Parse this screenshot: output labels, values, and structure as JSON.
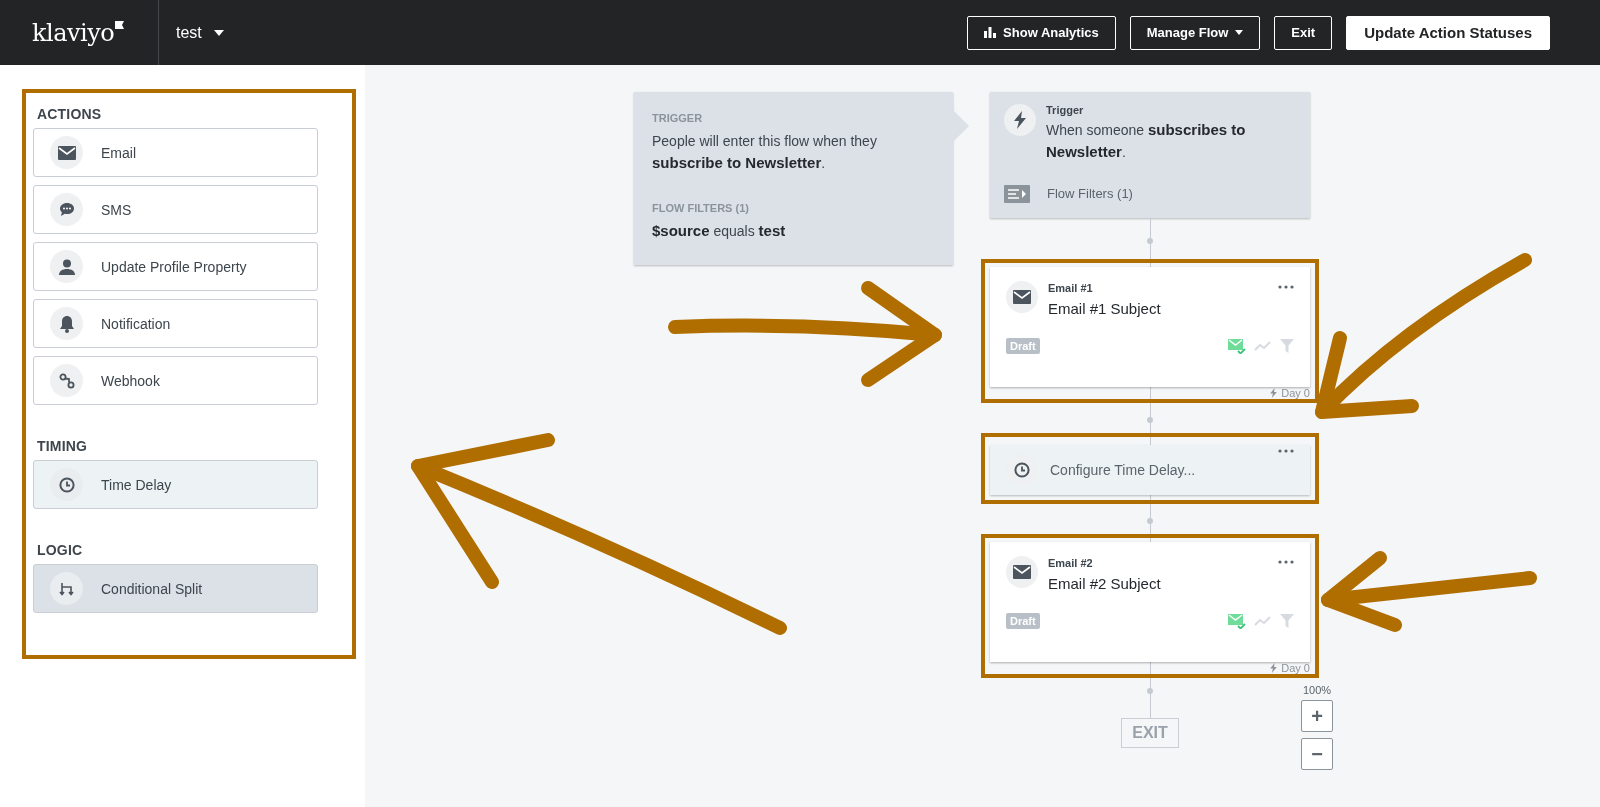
{
  "topbar": {
    "logo": "klaviyo",
    "flow_name": "test",
    "buttons": [
      {
        "label": "Show Analytics",
        "kind": "analytics"
      },
      {
        "label": "Manage Flow",
        "kind": "dropdown"
      },
      {
        "label": "Exit",
        "kind": "plain"
      },
      {
        "label": "Update Action Statuses",
        "kind": "primary"
      }
    ]
  },
  "sidebar": {
    "highlighted": true,
    "sections": [
      {
        "title": "ACTIONS",
        "kind": "action",
        "items": [
          {
            "label": "Email",
            "kind": "email"
          },
          {
            "label": "SMS",
            "kind": "sms"
          },
          {
            "label": "Update Profile Property",
            "kind": "profile"
          },
          {
            "label": "Notification",
            "kind": "notification"
          },
          {
            "label": "Webhook",
            "kind": "webhook"
          }
        ]
      },
      {
        "title": "TIMING",
        "kind": "timing",
        "items": [
          {
            "label": "Time Delay",
            "kind": "delay"
          }
        ]
      },
      {
        "title": "LOGIC",
        "kind": "logic",
        "items": [
          {
            "label": "Conditional Split",
            "kind": "split"
          }
        ]
      }
    ]
  },
  "trigger_info": {
    "label": "TRIGGER",
    "text": "People will enter this flow when they **subscribe to Newsletter**.",
    "filters_label": "FLOW FILTERS (1)",
    "filter": "**$source** equals **test**"
  },
  "trigger_card": {
    "label": "Trigger",
    "text": "When someone **subscribes to Newsletter**.",
    "filters": "Flow Filters (1)"
  },
  "flow": [
    {
      "kind": "email",
      "label": "Email #1",
      "subject": "Email #1 Subject",
      "status": "Draft",
      "day": "Day 0",
      "highlighted": true
    },
    {
      "kind": "delay",
      "label": "Configure Time Delay...",
      "highlighted": true
    },
    {
      "kind": "email",
      "label": "Email #2",
      "subject": "Email #2 Subject",
      "status": "Draft",
      "day": "Day 0",
      "highlighted": true
    }
  ],
  "exit": "EXIT",
  "zoom": {
    "level_text": "100%",
    "buttons": [
      "+",
      "−"
    ]
  }
}
